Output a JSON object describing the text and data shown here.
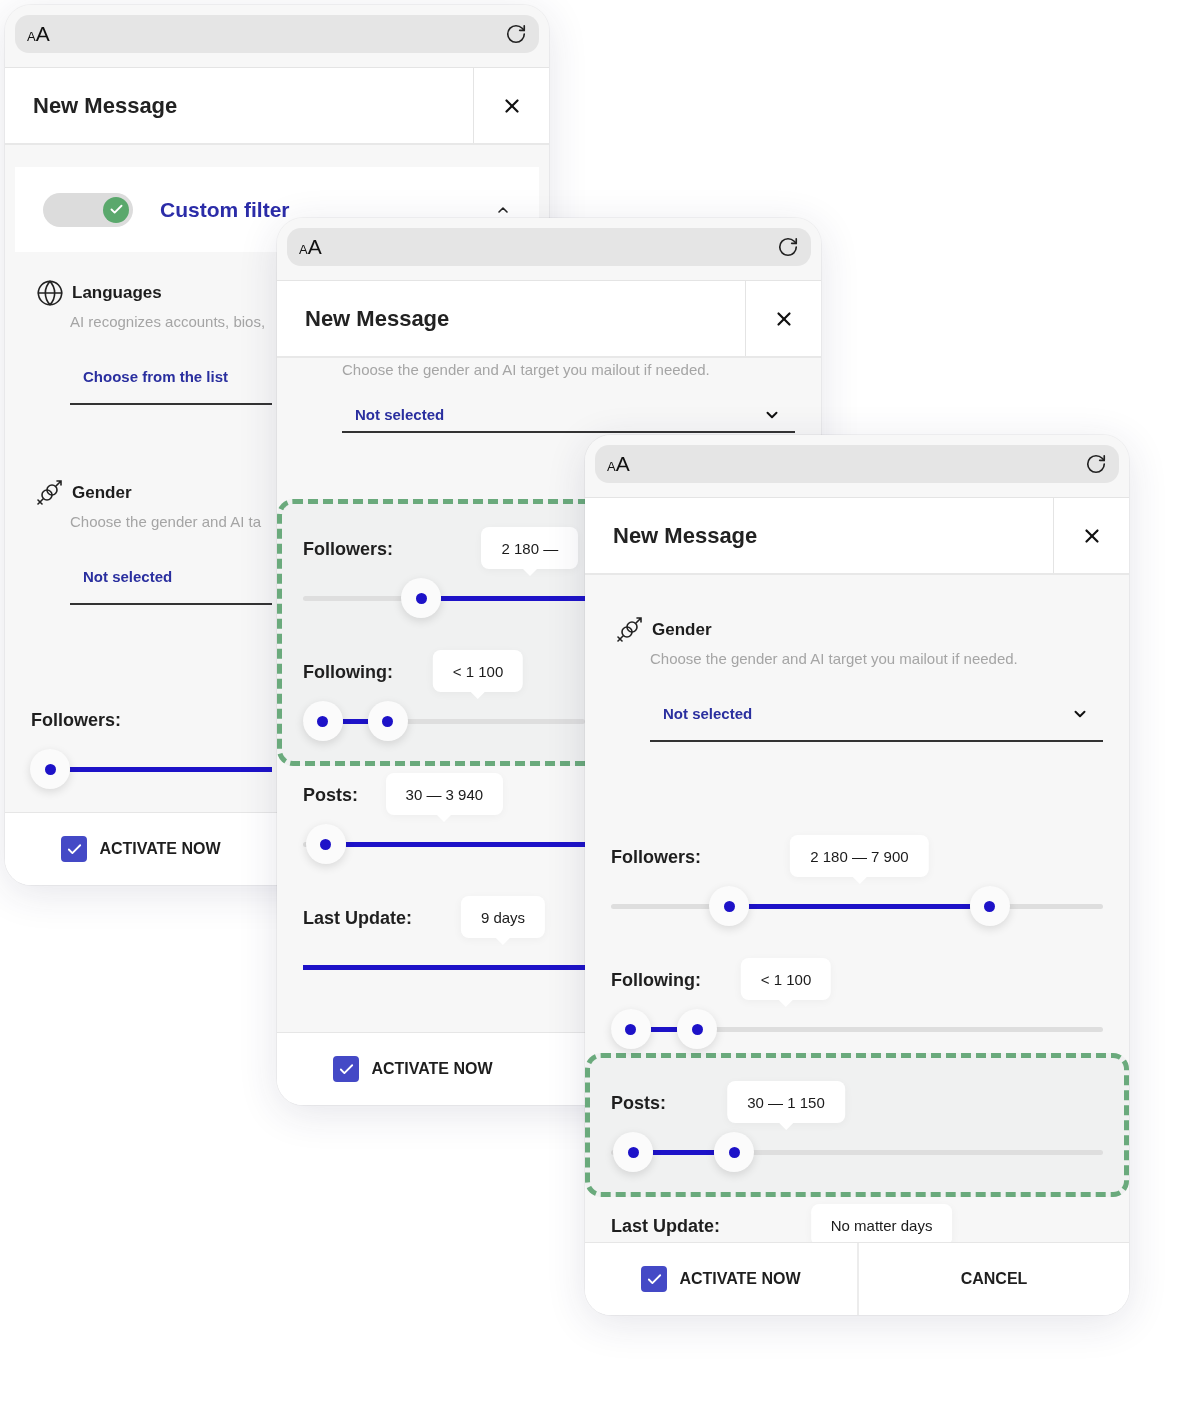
{
  "phones": [
    {
      "text_size": {
        "small": "A",
        "large": "A"
      },
      "title": "New Message",
      "scrolled": false,
      "content": [
        {
          "kind": "toggle_card",
          "label": "Custom filter",
          "on": true,
          "expanded": true
        },
        {
          "kind": "language_field",
          "title": "Languages",
          "description": "AI recognizes accounts, bios,",
          "value": "Choose from the list",
          "chevron": false
        },
        {
          "kind": "gender_field",
          "title": "Gender",
          "description": "Choose the gender and AI ta",
          "value": "Not selected",
          "chevron": false
        },
        {
          "kind": "slider",
          "label": "Followers:",
          "track": true,
          "handles": [
            {
              "level": 0.08
            }
          ]
        }
      ],
      "footer": {
        "activate": {
          "label": "ACTIVATE NOW",
          "checked": true
        }
      }
    },
    {
      "text_size": {
        "small": "A",
        "large": "A"
      },
      "title": "New Message",
      "scrolled": true,
      "content": [
        {
          "kind": "gender_field",
          "description": "Choose the gender and AI target you mailout if needed.",
          "value": "Not selected",
          "chevron": true
        },
        {
          "kind": "highlight",
          "items": [
            {
              "kind": "slider",
              "label": "Followers:",
              "reading": "2 180 —",
              "track": true,
              "handles": [
                {
                  "level": 0.42
                }
              ]
            },
            {
              "kind": "slider",
              "label": "Following:",
              "reading": "< 1 100",
              "track": true,
              "handles": [
                {
                  "level": 0.07
                },
                {
                  "level": 0.3
                }
              ]
            }
          ]
        },
        {
          "kind": "slider",
          "label": "Posts:",
          "reading": "30 — 3 940",
          "track": true,
          "handles": [
            {
              "level": 0.08
            }
          ]
        },
        {
          "kind": "slider",
          "label": "Last Update:",
          "reading": "9 days",
          "track": true,
          "level": 1
        }
      ],
      "footer": {
        "activate": {
          "label": "ACTIVATE NOW",
          "checked": true
        }
      }
    },
    {
      "text_size": {
        "small": "A",
        "large": "A"
      },
      "title": "New Message",
      "scrolled": false,
      "content": [
        {
          "kind": "gender_field",
          "title": "Gender",
          "description": "Choose the gender and AI target you mailout if needed.",
          "value": "Not selected",
          "chevron": true
        },
        {
          "kind": "slider",
          "label": "Followers:",
          "reading": "2 180 — 7 900",
          "track": true,
          "handles": [
            {
              "level": 0.24
            },
            {
              "level": 0.77
            }
          ]
        },
        {
          "kind": "slider",
          "label": "Following:",
          "reading": "< 1 100",
          "track": true,
          "handles": [
            {
              "level": 0.04
            },
            {
              "level": 0.175
            }
          ]
        },
        {
          "kind": "highlight",
          "items": [
            {
              "kind": "slider",
              "label": "Posts:",
              "reading": "30 — 1 150",
              "track": true,
              "handles": [
                {
                  "level": 0.045
                },
                {
                  "level": 0.25
                }
              ]
            }
          ]
        },
        {
          "kind": "slider",
          "label": "Last Update:",
          "reading": "No matter days",
          "track": false
        }
      ],
      "footer": {
        "activate": {
          "label": "ACTIVATE NOW",
          "checked": true
        },
        "cancel": "CANCEL"
      }
    }
  ]
}
